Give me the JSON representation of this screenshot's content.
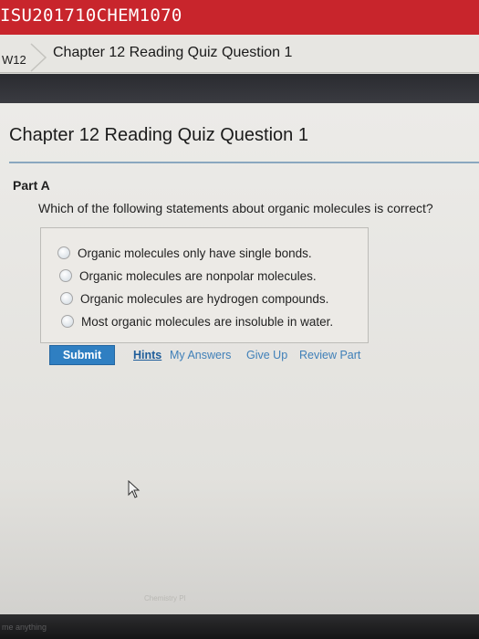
{
  "header": {
    "course_code": "ISU201710CHEM1070"
  },
  "breadcrumb": {
    "week": "W12",
    "current": "Chapter 12 Reading Quiz Question 1"
  },
  "main": {
    "title": "Chapter 12 Reading Quiz Question 1",
    "part_label": "Part A",
    "question": "Which of the following statements about organic molecules is correct?",
    "options": [
      "Organic molecules only have single bonds.",
      "Organic molecules are nonpolar molecules.",
      "Organic molecules are hydrogen compounds.",
      "Most organic molecules are insoluble in water."
    ],
    "selected_option": null
  },
  "actions": {
    "submit": "Submit",
    "hints": "Hints",
    "my_answers": "My Answers",
    "give_up": "Give Up",
    "review_part": "Review Part"
  },
  "footer": {
    "brand": "Chemistry Pl",
    "bottom_text": "me anything"
  },
  "colors": {
    "header_red": "#c8252c",
    "submit_blue": "#2f7fc2",
    "link_blue": "#3f7fb8",
    "rule_blue": "#8aa7bf"
  },
  "icons": {
    "breadcrumb_separator": "chevron-right-icon",
    "pointer": "mouse-pointer-icon"
  }
}
